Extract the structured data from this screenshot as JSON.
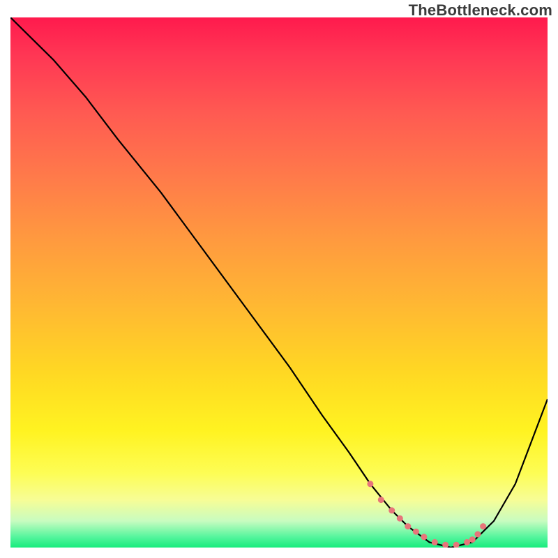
{
  "watermark": "TheBottleneck.com",
  "chart_data": {
    "type": "line",
    "title": "",
    "xlabel": "",
    "ylabel": "",
    "xlim": [
      0,
      100
    ],
    "ylim": [
      0,
      100
    ],
    "gradient_stops": [
      {
        "pos": 0,
        "color": "#ff1a4d"
      },
      {
        "pos": 7,
        "color": "#ff3654"
      },
      {
        "pos": 18,
        "color": "#ff5a52"
      },
      {
        "pos": 30,
        "color": "#ff7a4a"
      },
      {
        "pos": 42,
        "color": "#ff9a3f"
      },
      {
        "pos": 54,
        "color": "#ffb733"
      },
      {
        "pos": 67,
        "color": "#ffd823"
      },
      {
        "pos": 78,
        "color": "#fff321"
      },
      {
        "pos": 86,
        "color": "#fdfd55"
      },
      {
        "pos": 91,
        "color": "#f7fd96"
      },
      {
        "pos": 95,
        "color": "#c8fcc0"
      },
      {
        "pos": 98,
        "color": "#55f59d"
      },
      {
        "pos": 100,
        "color": "#18ec7d"
      }
    ],
    "series": [
      {
        "name": "bottleneck-curve",
        "color": "#000000",
        "x": [
          0,
          3,
          8,
          14,
          20,
          28,
          36,
          44,
          52,
          58,
          63,
          67,
          71,
          74,
          78,
          82,
          86,
          90,
          94,
          97,
          100
        ],
        "y": [
          100,
          97,
          92,
          85,
          77,
          67,
          56,
          45,
          34,
          25,
          18,
          12,
          7,
          4,
          1,
          0,
          1,
          5,
          12,
          20,
          28
        ]
      },
      {
        "name": "valley-markers",
        "type": "scatter",
        "color": "#e7757a",
        "x": [
          67,
          69,
          71,
          72.5,
          74,
          75.5,
          77,
          79,
          81,
          83,
          85,
          86,
          87,
          88
        ],
        "y": [
          12,
          9,
          7,
          5.5,
          4,
          3,
          2,
          1,
          0.5,
          0.5,
          1,
          1.5,
          2.5,
          4
        ]
      }
    ]
  }
}
